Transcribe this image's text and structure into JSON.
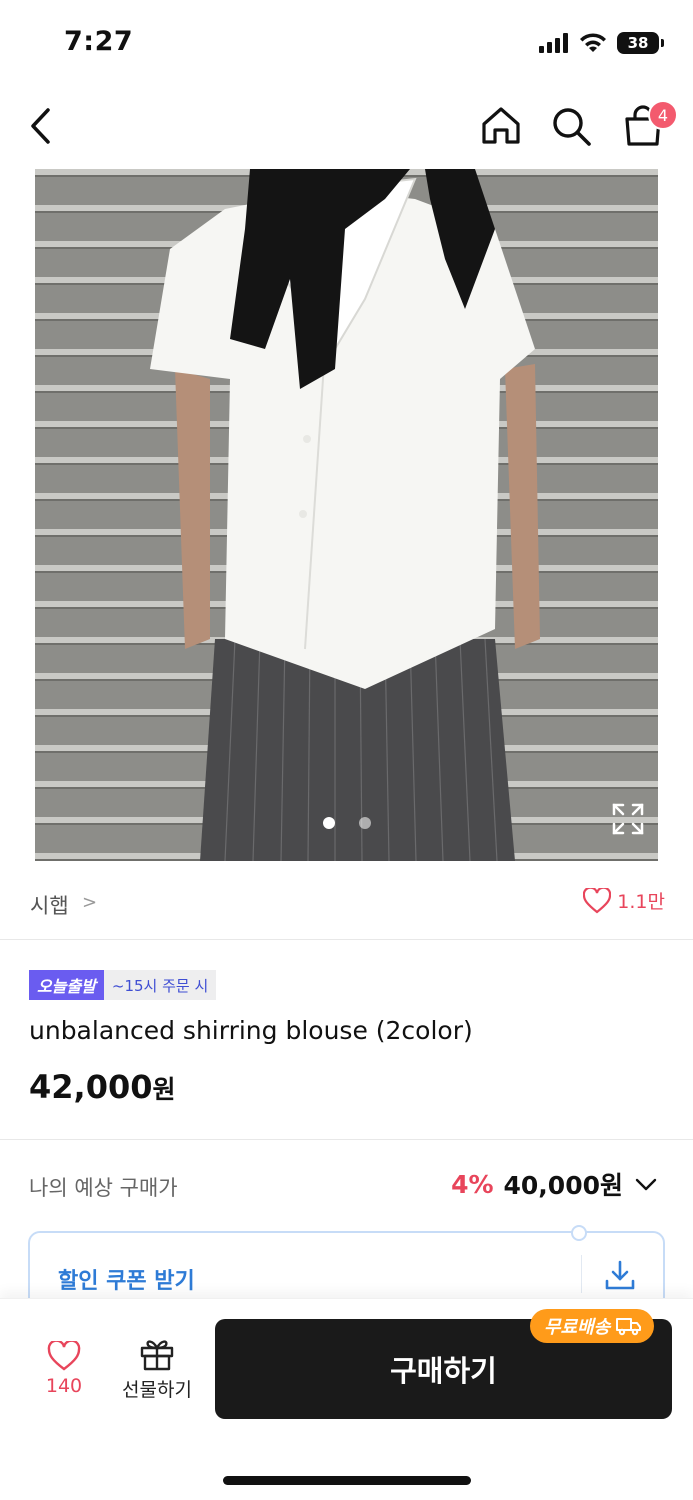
{
  "status_bar": {
    "time": "7:27",
    "battery": "38",
    "icons": [
      "signal-icon",
      "wifi-icon",
      "battery-icon"
    ]
  },
  "nav": {
    "icons": [
      "back-icon",
      "home-icon",
      "search-icon",
      "cart-icon"
    ],
    "cart_count": "4"
  },
  "gallery": {
    "total_images": 2,
    "current_index": 1
  },
  "brand": {
    "name": "시햅",
    "chevron": ">",
    "like_count": "1.1만"
  },
  "product": {
    "badge_primary": "오늘출발",
    "badge_secondary": "~15시 주문 시",
    "title": "unbalanced shirring blouse (2color)",
    "price": "42,000",
    "price_unit": "원"
  },
  "expected_price": {
    "label": "나의 예상 구매가",
    "discount_rate": "4%",
    "price": "40,000원"
  },
  "coupon": {
    "label": "할인 쿠폰 받기"
  },
  "bottom_bar": {
    "wish_count": "140",
    "gift_label": "선물하기",
    "buy_label": "구매하기",
    "free_shipping_label": "무료배송"
  },
  "colors": {
    "accent_red": "#e8455b",
    "badge_purple": "#6a5cf0",
    "coupon_blue": "#2e7bd6",
    "free_ship_orange": "#ff9b1a",
    "buy_button": "#1a1a1a"
  }
}
